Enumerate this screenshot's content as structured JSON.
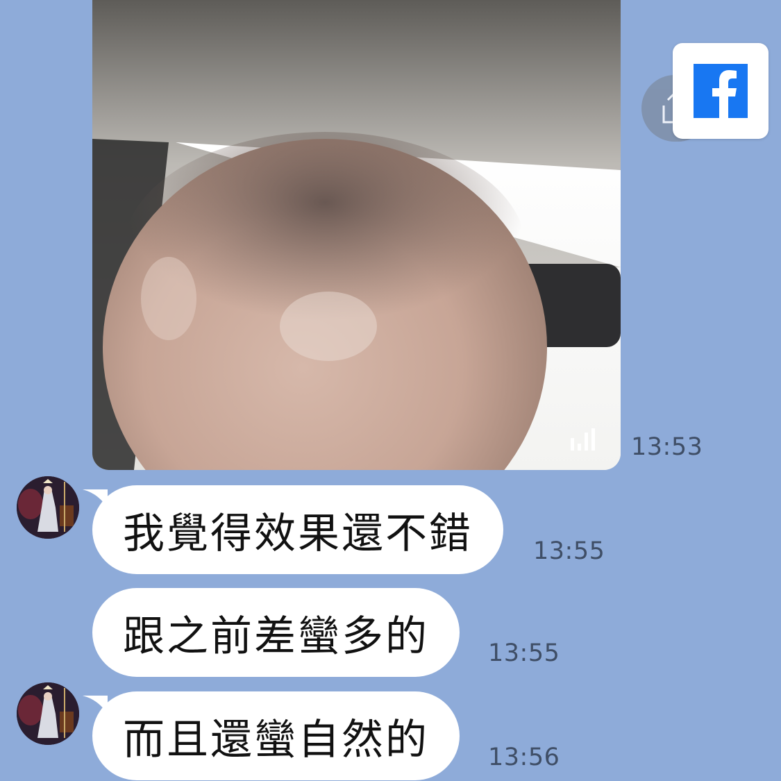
{
  "messages": [
    {
      "type": "video",
      "time": "13:53",
      "icon": "audio-bars-icon"
    },
    {
      "type": "text",
      "text": "我覺得效果還不錯",
      "time": "13:55",
      "avatar": true
    },
    {
      "type": "text",
      "text": "跟之前差蠻多的",
      "time": "13:55",
      "avatar": false
    },
    {
      "type": "text",
      "text": "而且還蠻自然的",
      "time": "13:56",
      "avatar": true
    }
  ],
  "overlay": {
    "share_icon": "share-icon",
    "badge_icon": "facebook-icon"
  },
  "colors": {
    "background": "#8eabd9",
    "bubble": "#ffffff",
    "text": "#111111",
    "timestamp": "#3f4e66",
    "facebook": "#1877f2"
  }
}
